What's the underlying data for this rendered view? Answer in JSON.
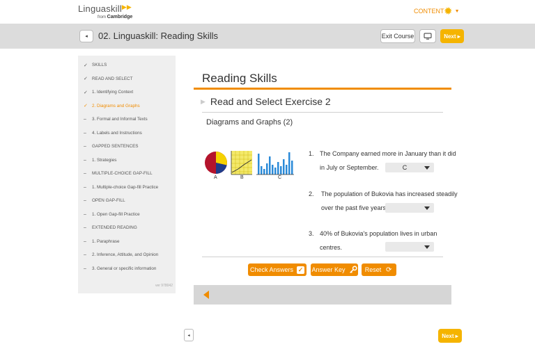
{
  "header": {
    "logo_name": "Linguaskill",
    "logo_from": "from",
    "logo_brand": "Cambridge",
    "content_link": "CONTENT",
    "settings_icon": "gear-icon"
  },
  "titlebar": {
    "back_label": "◂",
    "unit_title": "02. Linguaskill: Reading Skills",
    "exit_label": "Exit Course",
    "next_label": "Next ▸"
  },
  "sidebar": {
    "items": [
      {
        "marker": "✓",
        "label": "SKILLS"
      },
      {
        "marker": "✓",
        "label": "READ AND SELECT"
      },
      {
        "marker": "✓",
        "label": "1. Identifying Context"
      },
      {
        "marker": "✓",
        "label": "2. Diagrams and Graphs",
        "active": true
      },
      {
        "marker": "–",
        "label": "3. Formal and Informal Texts"
      },
      {
        "marker": "–",
        "label": "4. Labels and Instructions"
      },
      {
        "marker": "–",
        "label": "GAPPED SENTENCES"
      },
      {
        "marker": "–",
        "label": "1. Strategies"
      },
      {
        "marker": "–",
        "label": "MULTIPLE-CHOICE GAP-FILL"
      },
      {
        "marker": "–",
        "label": "1. Multiple-choice Gap-fill Practice"
      },
      {
        "marker": "–",
        "label": "OPEN GAP-FILL"
      },
      {
        "marker": "–",
        "label": "1. Open Gap-fill Practice"
      },
      {
        "marker": "–",
        "label": "EXTENDED READING"
      },
      {
        "marker": "–",
        "label": "1. Paraphrase"
      },
      {
        "marker": "–",
        "label": "2. Inference, Attitude, and Opinion"
      },
      {
        "marker": "–",
        "label": "3. General or specific information"
      }
    ],
    "version": "ver 978042"
  },
  "main": {
    "heading": "Reading Skills",
    "exercise_title": "Read and Select Exercise 2",
    "sub_title": "Diagrams and Graphs (2)",
    "chart_labels": [
      "A",
      "B",
      "C"
    ],
    "questions": [
      {
        "num": "1.",
        "line1": "The Company earned more in January than it did",
        "line2": "in July or September.",
        "selected": "C"
      },
      {
        "num": "2.",
        "line1": "The population of Bukovia has increased steadily",
        "line2": "over the past five years.",
        "selected": ""
      },
      {
        "num": "3.",
        "line1": "40% of Bukovia's population lives in urban",
        "line2": "centres.",
        "selected": ""
      }
    ],
    "buttons": {
      "check": "Check Answers",
      "key": "Answer Key",
      "reset": "Reset"
    }
  },
  "footer": {
    "back_label": "◂",
    "next_label": "Next ▸"
  },
  "colors": {
    "accent": "#f08c00",
    "next_yellow": "#f5b400"
  }
}
